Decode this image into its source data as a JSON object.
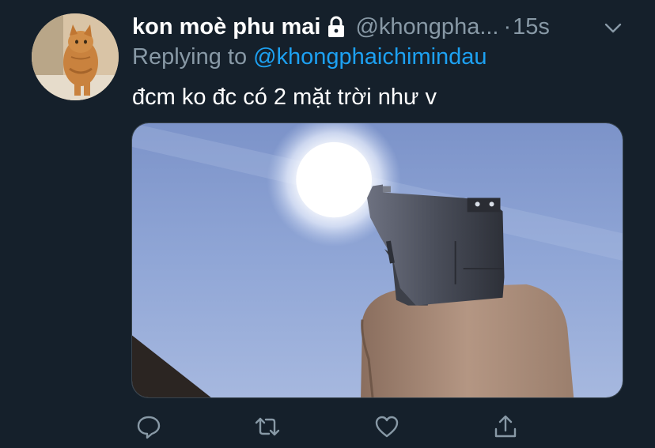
{
  "tweet": {
    "display_name": "kon moè phu mai",
    "handle": "@khongpha...",
    "separator": "·",
    "time": "15s",
    "replying_to_label": "Replying to",
    "replying_to_handle": "@khongphaichimindau",
    "text": "đcm ko đc có 2 mặt trời như v"
  },
  "icons": {
    "protected": "lock-icon",
    "menu": "chevron-down-icon",
    "reply": "comment-icon",
    "retweet": "retweet-icon",
    "like": "heart-icon",
    "share": "share-icon"
  },
  "colors": {
    "background": "#15202b",
    "primary_text": "#ffffff",
    "secondary_text": "#8899a6",
    "link": "#1da1f2"
  }
}
